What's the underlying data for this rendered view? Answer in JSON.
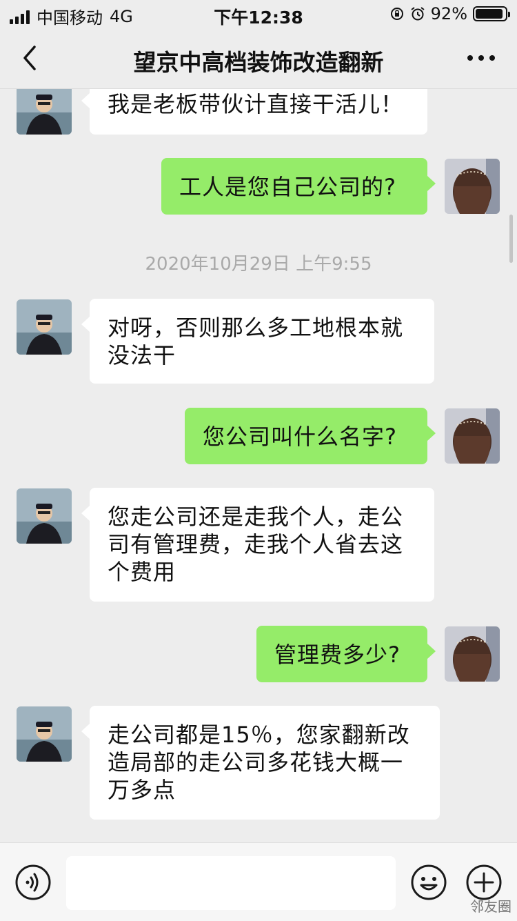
{
  "status_bar": {
    "carrier": "中国移动",
    "network": "4G",
    "time": "下午12:38",
    "battery_text": "92%",
    "battery_level": 0.92
  },
  "nav": {
    "title": "望京中高档装饰改造翻新",
    "back_icon": "chevron-left-icon",
    "more_icon": "more-dots-icon"
  },
  "messages": [
    {
      "side": "in",
      "text": "我是老板带伙计直接干活儿！"
    },
    {
      "side": "out",
      "text": "工人是您自己公司的?"
    },
    {
      "type": "timestamp",
      "text": "2020年10月29日 上午9:55"
    },
    {
      "side": "in",
      "text": "对呀，否则那么多工地根本就没法干"
    },
    {
      "side": "out",
      "text": "您公司叫什么名字?"
    },
    {
      "side": "in",
      "text": "您走公司还是走我个人，走公司有管理费，走我个人省去这个费用"
    },
    {
      "side": "out",
      "text": "管理费多少?"
    },
    {
      "side": "in",
      "text": "走公司都是15％，您家翻新改造局部的走公司多花钱大概一万多点"
    }
  ],
  "input_bar": {
    "voice_icon": "voice-icon",
    "emoji_icon": "emoji-icon",
    "plus_icon": "plus-icon",
    "input_value": ""
  },
  "watermark": "邻友圈",
  "colors": {
    "background": "#ededed",
    "outgoing_bubble": "#95ec69",
    "incoming_bubble": "#ffffff",
    "timestamp_text": "#a9a9a9"
  }
}
